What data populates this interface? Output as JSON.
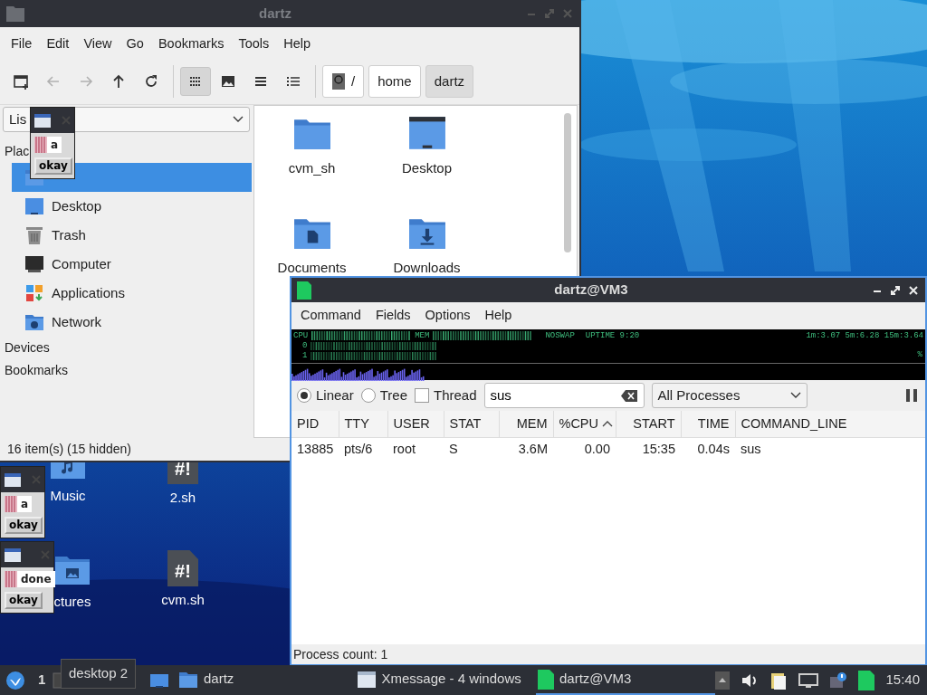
{
  "file_manager": {
    "title": "dartz",
    "active": false,
    "menu": [
      "File",
      "Edit",
      "View",
      "Go",
      "Bookmarks",
      "Tools",
      "Help"
    ],
    "toolbar": [
      {
        "kind": "new-window",
        "disabled": false
      },
      {
        "kind": "back",
        "disabled": true
      },
      {
        "kind": "forward",
        "disabled": true
      },
      {
        "kind": "up",
        "disabled": false
      },
      {
        "kind": "reload",
        "disabled": false
      }
    ],
    "view_buttons": [
      {
        "kind": "icons",
        "selected": true
      },
      {
        "kind": "thumbnails",
        "selected": false
      },
      {
        "kind": "compact",
        "selected": false
      },
      {
        "kind": "details",
        "selected": false
      }
    ],
    "path": [
      {
        "label": "/",
        "kind": "root",
        "selected": false
      },
      {
        "label": "home",
        "kind": "folder",
        "selected": false
      },
      {
        "label": "dartz",
        "kind": "folder",
        "selected": true
      }
    ],
    "side_pane_mode": "Lis",
    "places_heading": "Plac",
    "places": [
      {
        "kind": "home",
        "selected": true
      },
      {
        "label": "Desktop",
        "kind": "desktop",
        "selected": false
      },
      {
        "label": "Trash",
        "kind": "trash",
        "selected": false
      },
      {
        "label": "Computer",
        "kind": "computer",
        "selected": false
      },
      {
        "label": "Applications",
        "kind": "applications",
        "selected": false
      },
      {
        "label": "Network",
        "kind": "network",
        "selected": false
      }
    ],
    "sections": [
      "Devices",
      "Bookmarks"
    ],
    "files": [
      {
        "name": "cvm_sh",
        "kind": "folder"
      },
      {
        "name": "Desktop",
        "kind": "desktop"
      },
      {
        "name": "Documents",
        "kind": "documents"
      },
      {
        "name": "Downloads",
        "kind": "downloads"
      }
    ],
    "status": "16 item(s) (15 hidden)"
  },
  "desktop_icons": [
    {
      "name": "Music",
      "kind": "music"
    },
    {
      "name": "2.sh",
      "kind": "script",
      "glyph": "#!"
    },
    {
      "name": "ctures",
      "kind": "pictures"
    },
    {
      "name": "cvm.sh",
      "kind": "script",
      "glyph": "#!"
    }
  ],
  "xmessages": [
    {
      "message": "a",
      "button": "okay"
    },
    {
      "message": "a",
      "button": "okay"
    },
    {
      "message": "done",
      "button": "okay"
    }
  ],
  "task_manager": {
    "title": "dartz@VM3",
    "active": true,
    "menu": [
      "Command",
      "Fields",
      "Options",
      "Help"
    ],
    "monitor": {
      "cpu_label": "CPU",
      "mem_label": "MEM",
      "swap": "NOSWAP",
      "uptime": "UPTIME 9:20",
      "load": "1m:3.07 5m:6.28 15m:3.64",
      "cores": [
        "0",
        "1"
      ],
      "scale": "%"
    },
    "view_modes": [
      {
        "label": "Linear",
        "selected": true
      },
      {
        "label": "Tree",
        "selected": false
      }
    ],
    "thread": {
      "label": "Thread",
      "checked": false
    },
    "filter": "sus",
    "process_filter": "All Processes",
    "columns": [
      {
        "label": "PID",
        "sorted": false
      },
      {
        "label": "TTY",
        "sorted": false
      },
      {
        "label": "USER",
        "sorted": false
      },
      {
        "label": "STAT",
        "sorted": false
      },
      {
        "label": "MEM",
        "sorted": false
      },
      {
        "label": "%CPU",
        "sorted": true
      },
      {
        "label": "START",
        "sorted": false
      },
      {
        "label": "TIME",
        "sorted": false
      },
      {
        "label": "COMMAND_LINE",
        "sorted": false
      }
    ],
    "rows": [
      [
        "13885",
        "pts/6",
        "root",
        "S",
        "3.6M",
        "0.00",
        "15:35",
        "0.04s",
        "sus"
      ]
    ],
    "status": "Process count: 1"
  },
  "taskbar": {
    "workspace": "1",
    "tooltip": "desktop 2",
    "tasks": [
      {
        "label": "dartz",
        "kind": "folder",
        "active": false
      },
      {
        "label": "Xmessage - 4 windows",
        "kind": "xmessage",
        "active": false
      },
      {
        "label": "dartz@VM3",
        "kind": "terminal",
        "active": true
      }
    ],
    "clock": "15:40"
  }
}
